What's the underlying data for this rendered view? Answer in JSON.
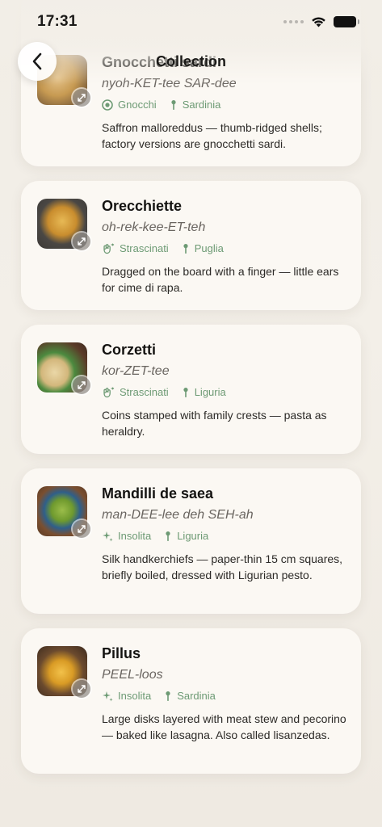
{
  "status": {
    "time": "17:31"
  },
  "nav": {
    "title": "Collection"
  },
  "cards": [
    {
      "name": "Gnocchetti sardi",
      "pronunciation": "nyoh-KET-tee SAR-dee",
      "type": "Gnocchi",
      "region": "Sardinia",
      "description": "Saffron malloreddus — thumb-ridged shells; factory versions are gnocchetti sardi.",
      "type_icon": "target-icon"
    },
    {
      "name": "Orecchiette",
      "pronunciation": "oh-rek-kee-ET-teh",
      "type": "Strascinati",
      "region": "Puglia",
      "description": "Dragged on the board with a finger — little ears for cime di rapa.",
      "type_icon": "drag-hand-icon"
    },
    {
      "name": "Corzetti",
      "pronunciation": "kor-ZET-tee",
      "type": "Strascinati",
      "region": "Liguria",
      "description": "Coins stamped with family crests — pasta as heraldry.",
      "type_icon": "drag-hand-icon"
    },
    {
      "name": "Mandilli de saea",
      "pronunciation": "man-DEE-lee deh SEH-ah",
      "type": "Insolita",
      "region": "Liguria",
      "description": "Silk handkerchiefs — paper-thin 15 cm squares, briefly boiled, dressed with Ligurian pesto.",
      "type_icon": "sparkle-icon"
    },
    {
      "name": "Pillus",
      "pronunciation": "PEEL-loos",
      "type": "Insolita",
      "region": "Sardinia",
      "description": "Large disks layered with meat stew and pecorino — baked like lasagna. Also called lisanzedas.",
      "type_icon": "sparkle-icon"
    }
  ],
  "colors": {
    "accent": "#6d9a74",
    "card": "#fbf8f3",
    "background": "#f1ede6"
  }
}
